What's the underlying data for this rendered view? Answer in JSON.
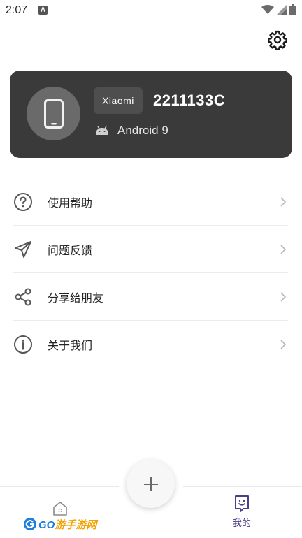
{
  "status_bar": {
    "time": "2:07",
    "notification_badge": "A"
  },
  "device": {
    "brand": "Xiaomi",
    "model": "2211133C",
    "os": "Android 9"
  },
  "menu": {
    "items": [
      {
        "label": "使用帮助",
        "icon": "help-circle-icon"
      },
      {
        "label": "问题反馈",
        "icon": "send-icon"
      },
      {
        "label": "分享给朋友",
        "icon": "share-icon"
      },
      {
        "label": "关于我们",
        "icon": "info-icon"
      }
    ]
  },
  "bottom_nav": {
    "home_icon": "home-icon",
    "add_icon": "plus-icon",
    "mine_label": "我的",
    "watermark": {
      "prefix": "GO",
      "highlight": "游手游网"
    }
  },
  "colors": {
    "card_bg": "#3a3a3a",
    "accent_purple": "#4a3f8a",
    "text_primary": "#222222"
  }
}
